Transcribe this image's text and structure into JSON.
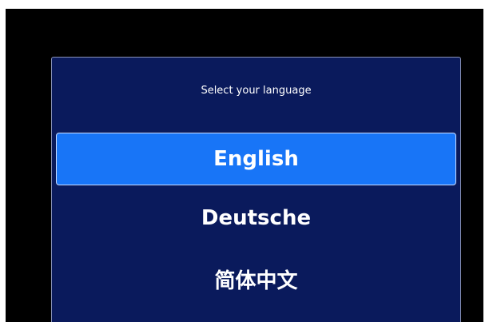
{
  "dialog": {
    "prompt": "Select your language",
    "options": [
      {
        "label": "English",
        "selected": true
      },
      {
        "label": "Deutsche",
        "selected": false
      },
      {
        "label": "简体中文",
        "selected": false
      }
    ]
  },
  "colors": {
    "screen_background": "#000000",
    "dialog_background": "#0a1a5c",
    "selected_background": "#1875f7",
    "text": "#ffffff"
  }
}
